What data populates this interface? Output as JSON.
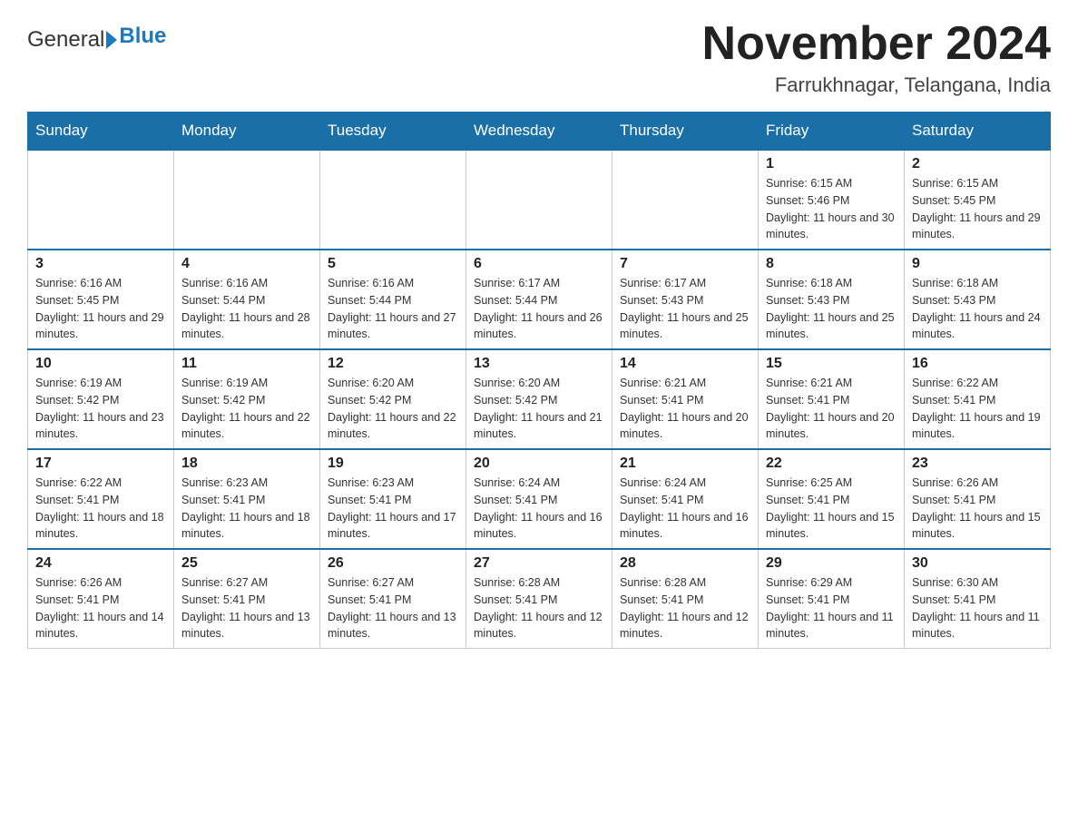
{
  "logo": {
    "text_general": "General",
    "text_blue": "Blue",
    "alt": "GeneralBlue logo"
  },
  "header": {
    "title": "November 2024",
    "subtitle": "Farrukhnagar, Telangana, India"
  },
  "weekdays": [
    "Sunday",
    "Monday",
    "Tuesday",
    "Wednesday",
    "Thursday",
    "Friday",
    "Saturday"
  ],
  "weeks": [
    [
      {
        "day": "",
        "sunrise": "",
        "sunset": "",
        "daylight": ""
      },
      {
        "day": "",
        "sunrise": "",
        "sunset": "",
        "daylight": ""
      },
      {
        "day": "",
        "sunrise": "",
        "sunset": "",
        "daylight": ""
      },
      {
        "day": "",
        "sunrise": "",
        "sunset": "",
        "daylight": ""
      },
      {
        "day": "",
        "sunrise": "",
        "sunset": "",
        "daylight": ""
      },
      {
        "day": "1",
        "sunrise": "Sunrise: 6:15 AM",
        "sunset": "Sunset: 5:46 PM",
        "daylight": "Daylight: 11 hours and 30 minutes."
      },
      {
        "day": "2",
        "sunrise": "Sunrise: 6:15 AM",
        "sunset": "Sunset: 5:45 PM",
        "daylight": "Daylight: 11 hours and 29 minutes."
      }
    ],
    [
      {
        "day": "3",
        "sunrise": "Sunrise: 6:16 AM",
        "sunset": "Sunset: 5:45 PM",
        "daylight": "Daylight: 11 hours and 29 minutes."
      },
      {
        "day": "4",
        "sunrise": "Sunrise: 6:16 AM",
        "sunset": "Sunset: 5:44 PM",
        "daylight": "Daylight: 11 hours and 28 minutes."
      },
      {
        "day": "5",
        "sunrise": "Sunrise: 6:16 AM",
        "sunset": "Sunset: 5:44 PM",
        "daylight": "Daylight: 11 hours and 27 minutes."
      },
      {
        "day": "6",
        "sunrise": "Sunrise: 6:17 AM",
        "sunset": "Sunset: 5:44 PM",
        "daylight": "Daylight: 11 hours and 26 minutes."
      },
      {
        "day": "7",
        "sunrise": "Sunrise: 6:17 AM",
        "sunset": "Sunset: 5:43 PM",
        "daylight": "Daylight: 11 hours and 25 minutes."
      },
      {
        "day": "8",
        "sunrise": "Sunrise: 6:18 AM",
        "sunset": "Sunset: 5:43 PM",
        "daylight": "Daylight: 11 hours and 25 minutes."
      },
      {
        "day": "9",
        "sunrise": "Sunrise: 6:18 AM",
        "sunset": "Sunset: 5:43 PM",
        "daylight": "Daylight: 11 hours and 24 minutes."
      }
    ],
    [
      {
        "day": "10",
        "sunrise": "Sunrise: 6:19 AM",
        "sunset": "Sunset: 5:42 PM",
        "daylight": "Daylight: 11 hours and 23 minutes."
      },
      {
        "day": "11",
        "sunrise": "Sunrise: 6:19 AM",
        "sunset": "Sunset: 5:42 PM",
        "daylight": "Daylight: 11 hours and 22 minutes."
      },
      {
        "day": "12",
        "sunrise": "Sunrise: 6:20 AM",
        "sunset": "Sunset: 5:42 PM",
        "daylight": "Daylight: 11 hours and 22 minutes."
      },
      {
        "day": "13",
        "sunrise": "Sunrise: 6:20 AM",
        "sunset": "Sunset: 5:42 PM",
        "daylight": "Daylight: 11 hours and 21 minutes."
      },
      {
        "day": "14",
        "sunrise": "Sunrise: 6:21 AM",
        "sunset": "Sunset: 5:41 PM",
        "daylight": "Daylight: 11 hours and 20 minutes."
      },
      {
        "day": "15",
        "sunrise": "Sunrise: 6:21 AM",
        "sunset": "Sunset: 5:41 PM",
        "daylight": "Daylight: 11 hours and 20 minutes."
      },
      {
        "day": "16",
        "sunrise": "Sunrise: 6:22 AM",
        "sunset": "Sunset: 5:41 PM",
        "daylight": "Daylight: 11 hours and 19 minutes."
      }
    ],
    [
      {
        "day": "17",
        "sunrise": "Sunrise: 6:22 AM",
        "sunset": "Sunset: 5:41 PM",
        "daylight": "Daylight: 11 hours and 18 minutes."
      },
      {
        "day": "18",
        "sunrise": "Sunrise: 6:23 AM",
        "sunset": "Sunset: 5:41 PM",
        "daylight": "Daylight: 11 hours and 18 minutes."
      },
      {
        "day": "19",
        "sunrise": "Sunrise: 6:23 AM",
        "sunset": "Sunset: 5:41 PM",
        "daylight": "Daylight: 11 hours and 17 minutes."
      },
      {
        "day": "20",
        "sunrise": "Sunrise: 6:24 AM",
        "sunset": "Sunset: 5:41 PM",
        "daylight": "Daylight: 11 hours and 16 minutes."
      },
      {
        "day": "21",
        "sunrise": "Sunrise: 6:24 AM",
        "sunset": "Sunset: 5:41 PM",
        "daylight": "Daylight: 11 hours and 16 minutes."
      },
      {
        "day": "22",
        "sunrise": "Sunrise: 6:25 AM",
        "sunset": "Sunset: 5:41 PM",
        "daylight": "Daylight: 11 hours and 15 minutes."
      },
      {
        "day": "23",
        "sunrise": "Sunrise: 6:26 AM",
        "sunset": "Sunset: 5:41 PM",
        "daylight": "Daylight: 11 hours and 15 minutes."
      }
    ],
    [
      {
        "day": "24",
        "sunrise": "Sunrise: 6:26 AM",
        "sunset": "Sunset: 5:41 PM",
        "daylight": "Daylight: 11 hours and 14 minutes."
      },
      {
        "day": "25",
        "sunrise": "Sunrise: 6:27 AM",
        "sunset": "Sunset: 5:41 PM",
        "daylight": "Daylight: 11 hours and 13 minutes."
      },
      {
        "day": "26",
        "sunrise": "Sunrise: 6:27 AM",
        "sunset": "Sunset: 5:41 PM",
        "daylight": "Daylight: 11 hours and 13 minutes."
      },
      {
        "day": "27",
        "sunrise": "Sunrise: 6:28 AM",
        "sunset": "Sunset: 5:41 PM",
        "daylight": "Daylight: 11 hours and 12 minutes."
      },
      {
        "day": "28",
        "sunrise": "Sunrise: 6:28 AM",
        "sunset": "Sunset: 5:41 PM",
        "daylight": "Daylight: 11 hours and 12 minutes."
      },
      {
        "day": "29",
        "sunrise": "Sunrise: 6:29 AM",
        "sunset": "Sunset: 5:41 PM",
        "daylight": "Daylight: 11 hours and 11 minutes."
      },
      {
        "day": "30",
        "sunrise": "Sunrise: 6:30 AM",
        "sunset": "Sunset: 5:41 PM",
        "daylight": "Daylight: 11 hours and 11 minutes."
      }
    ]
  ]
}
